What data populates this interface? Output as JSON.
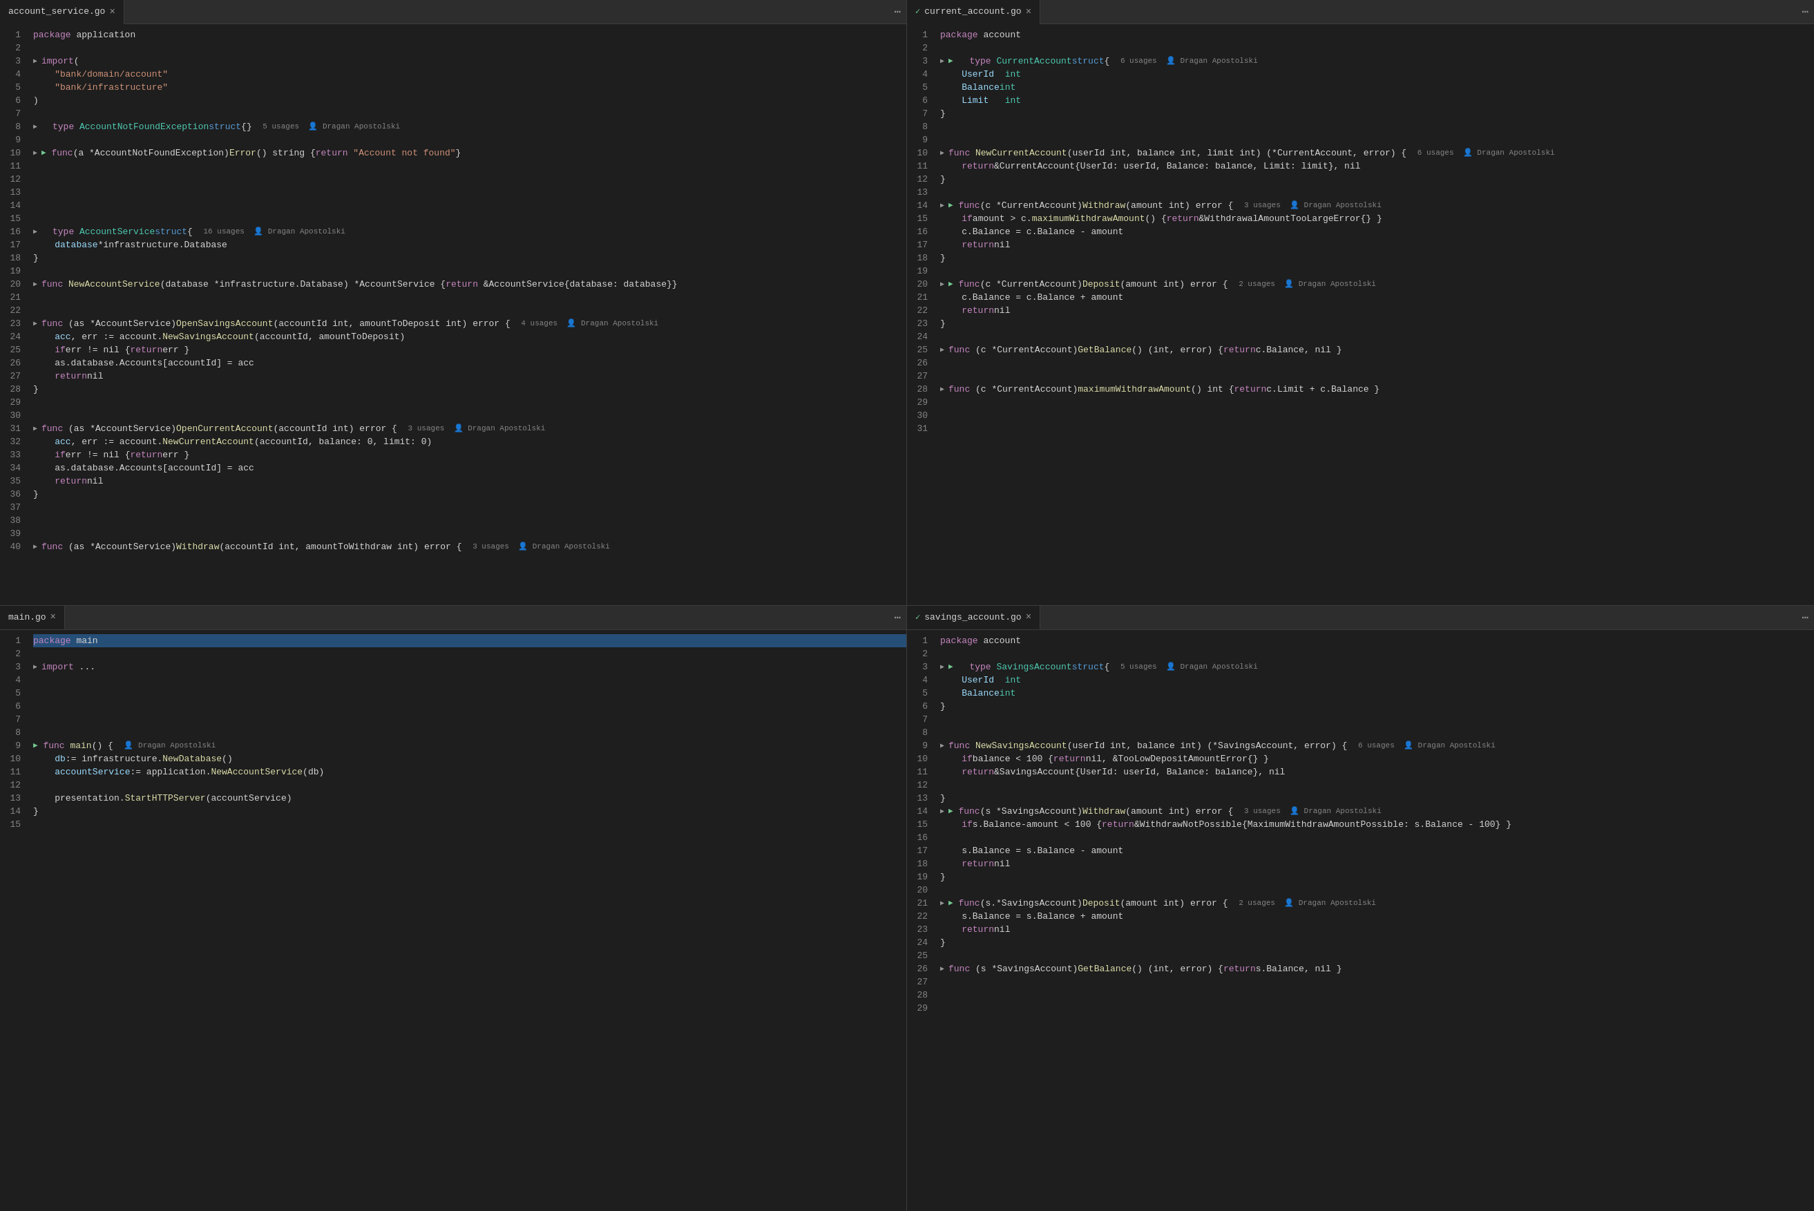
{
  "panes": [
    {
      "id": "account-service",
      "tab_name": "account_service.go",
      "tab_modified": false,
      "tab_active": true,
      "show_checkmark": false,
      "lines": [
        {
          "n": 1,
          "code": "<span class='kw'>package</span> <span class='plain'>application</span>"
        },
        {
          "n": 2,
          "code": ""
        },
        {
          "n": 3,
          "code": "<span class='kw'>import</span> <span class='plain'>(</span>"
        },
        {
          "n": 4,
          "code": "    <span class='str'>\"bank/domain/account\"</span>"
        },
        {
          "n": 5,
          "code": "    <span class='str'>\"bank/infrastructure\"</span>"
        },
        {
          "n": 6,
          "code": "<span class='plain'>)</span>"
        },
        {
          "n": 7,
          "code": ""
        },
        {
          "n": 8,
          "fold": true,
          "meta": "5 usages  👤 Dragan Apostolski",
          "code": "<span class='kw'>type</span> <span class='type'>AccountNotFoundException</span> <span class='kw-blue'>struct</span><span class='plain'>{}</span>"
        },
        {
          "n": 9,
          "code": ""
        },
        {
          "n": 10,
          "fold": true,
          "run": true,
          "meta": "",
          "code": "<span class='kw'>func</span> <span class='plain'>(a *AccountNotFoundException)</span> <span class='fn'>Error</span><span class='plain'>() string { </span><span class='kw'>return</span> <span class='str'>\"Account not found\"</span> <span class='plain'>}</span>"
        },
        {
          "n": 11,
          "code": ""
        },
        {
          "n": 12,
          "code": ""
        },
        {
          "n": 13,
          "code": ""
        },
        {
          "n": 14,
          "code": ""
        },
        {
          "n": 15,
          "code": ""
        },
        {
          "n": 16,
          "fold": true,
          "meta": "16 usages  👤 Dragan Apostolski",
          "code": "<span class='kw'>type</span> <span class='type'>AccountService</span> <span class='kw-blue'>struct</span> <span class='plain'>{</span>"
        },
        {
          "n": 17,
          "code": "    <span class='param'>database</span> <span class='plain'>*infrastructure.Database</span>"
        },
        {
          "n": 18,
          "code": "<span class='plain'>}</span>"
        },
        {
          "n": 19,
          "code": ""
        },
        {
          "n": 20,
          "fold": true,
          "code": "<span class='kw'>func</span> <span class='fn'>NewAccountService</span><span class='plain'>(database *infrastructure.Database) *AccountService { </span><span class='kw'>return</span> <span class='plain'>&AccountService{database: database}</span> <span class='plain'>}</span>"
        },
        {
          "n": 21,
          "code": ""
        },
        {
          "n": 22,
          "code": ""
        },
        {
          "n": 23,
          "fold": true,
          "meta": "4 usages  👤 Dragan Apostolski",
          "code": "<span class='kw'>func</span> <span class='plain'>(as *AccountService)</span> <span class='fn'>OpenSavingsAccount</span><span class='plain'>(accountId int, amountToDeposit int) error {</span>"
        },
        {
          "n": 24,
          "code": "    <span class='param'>acc</span><span class='plain'>, err := account.</span><span class='fn'>NewSavingsAccount</span><span class='plain'>(accountId, amountToDeposit)</span>"
        },
        {
          "n": 25,
          "code": "    <span class='kw'>if</span> <span class='plain'>err != nil {</span> <span class='kw'>return</span> <span class='plain'>err }</span>"
        },
        {
          "n": 26,
          "code": "    <span class='plain'>as.database.Accounts[accountId] = acc</span>"
        },
        {
          "n": 27,
          "code": "    <span class='kw'>return</span> <span class='plain'>nil</span>"
        },
        {
          "n": 28,
          "code": "<span class='plain'>}</span>"
        },
        {
          "n": 29,
          "code": ""
        },
        {
          "n": 30,
          "code": ""
        },
        {
          "n": 31,
          "fold": true,
          "meta": "3 usages  👤 Dragan Apostolski",
          "code": "<span class='kw'>func</span> <span class='plain'>(as *AccountService)</span> <span class='fn'>OpenCurrentAccount</span><span class='plain'>(accountId int) error {</span>"
        },
        {
          "n": 32,
          "code": "    <span class='param'>acc</span><span class='plain'>, err := account.</span><span class='fn'>NewCurrentAccount</span><span class='plain'>(accountId, balance: 0, limit: 0)</span>"
        },
        {
          "n": 33,
          "code": "    <span class='kw'>if</span> <span class='plain'>err != nil {</span> <span class='kw'>return</span> <span class='plain'>err }</span>"
        },
        {
          "n": 34,
          "code": "    <span class='plain'>as.database.Accounts[accountId] = acc</span>"
        },
        {
          "n": 35,
          "code": "    <span class='kw'>return</span> <span class='plain'>nil</span>"
        },
        {
          "n": 36,
          "code": "<span class='plain'>}</span>"
        },
        {
          "n": 37,
          "code": ""
        },
        {
          "n": 38,
          "code": ""
        },
        {
          "n": 39,
          "code": ""
        },
        {
          "n": 40,
          "fold": true,
          "meta": "3 usages  👤 Dragan Apostolski",
          "code": "<span class='kw'>func</span> <span class='plain'>(as *AccountService)</span> <span class='fn'>Withdraw</span><span class='plain'>(accountId int, amountToWithdraw int) error {</span>"
        }
      ]
    },
    {
      "id": "current-account",
      "tab_name": "current_account.go",
      "tab_modified": false,
      "tab_active": true,
      "show_checkmark": true,
      "lines": [
        {
          "n": 1,
          "code": "<span class='kw'>package</span> <span class='plain'>account</span>"
        },
        {
          "n": 2,
          "code": ""
        },
        {
          "n": 3,
          "fold": true,
          "run": true,
          "meta": "6 usages  👤 Dragan Apostolski",
          "code": "<span class='kw'>type</span> <span class='type'>CurrentAccount</span> <span class='kw-blue'>struct</span> <span class='plain'>{</span>"
        },
        {
          "n": 4,
          "code": "    <span class='param'>UserId</span>  <span class='type'>int</span>"
        },
        {
          "n": 5,
          "code": "    <span class='param'>Balance</span> <span class='type'>int</span>"
        },
        {
          "n": 6,
          "code": "    <span class='param'>Limit</span>   <span class='type'>int</span>"
        },
        {
          "n": 7,
          "code": "<span class='plain'>}</span>"
        },
        {
          "n": 8,
          "code": ""
        },
        {
          "n": 9,
          "code": ""
        },
        {
          "n": 10,
          "fold": true,
          "meta": "6 usages  👤 Dragan Apostolski",
          "code": "<span class='kw'>func</span> <span class='fn'>NewCurrentAccount</span><span class='plain'>(userId int, balance int, limit int) (*CurrentAccount, error) {</span>"
        },
        {
          "n": 11,
          "code": "    <span class='kw'>return</span> <span class='plain'>&CurrentAccount{UserId: userId, Balance: balance, Limit: limit}, nil</span>"
        },
        {
          "n": 12,
          "code": "<span class='plain'>}</span>"
        },
        {
          "n": 13,
          "code": ""
        },
        {
          "n": 14,
          "fold": true,
          "run": true,
          "meta": "3 usages  👤 Dragan Apostolski",
          "code": "<span class='kw'>func</span> <span class='plain'>(c *CurrentAccount)</span> <span class='fn'>Withdraw</span><span class='plain'>(amount int) error {</span>"
        },
        {
          "n": 15,
          "code": "    <span class='kw'>if</span> <span class='plain'>amount > c.</span><span class='fn'>maximumWithdrawAmount</span><span class='plain'>() { </span><span class='kw'>return</span> <span class='plain'>&WithdrawalAmountTooLargeError{} }</span>"
        },
        {
          "n": 16,
          "code": "    <span class='plain'>c.Balance = c.Balance - amount</span>"
        },
        {
          "n": 17,
          "code": "    <span class='kw'>return</span> <span class='plain'>nil</span>"
        },
        {
          "n": 18,
          "code": "<span class='plain'>}</span>"
        },
        {
          "n": 19,
          "code": ""
        },
        {
          "n": 20,
          "fold": true,
          "run": true,
          "meta": "2 usages  👤 Dragan Apostolski",
          "code": "<span class='kw'>func</span> <span class='plain'>(c *CurrentAccount)</span> <span class='fn'>Deposit</span><span class='plain'>(amount int) error {</span>"
        },
        {
          "n": 21,
          "code": "    <span class='plain'>c.Balance = c.Balance + amount</span>"
        },
        {
          "n": 22,
          "code": "    <span class='kw'>return</span> <span class='plain'>nil</span>"
        },
        {
          "n": 23,
          "code": "<span class='plain'>}</span>"
        },
        {
          "n": 24,
          "code": ""
        },
        {
          "n": 25,
          "fold": true,
          "code": "<span class='kw'>func</span> <span class='plain'>(c *CurrentAccount)</span> <span class='fn'>GetBalance</span><span class='plain'>() (int, error) { </span><span class='kw'>return</span> <span class='plain'>c.Balance, nil }</span>"
        },
        {
          "n": 26,
          "code": ""
        },
        {
          "n": 27,
          "code": ""
        },
        {
          "n": 28,
          "fold": true,
          "code": "<span class='kw'>func</span> <span class='plain'>(c *CurrentAccount)</span> <span class='fn'>maximumWithdrawAmount</span><span class='plain'>() int { </span><span class='kw'>return</span> <span class='plain'>c.Limit + c.Balance }</span>"
        },
        {
          "n": 29,
          "code": ""
        },
        {
          "n": 30,
          "code": ""
        },
        {
          "n": 31,
          "code": ""
        }
      ]
    },
    {
      "id": "main",
      "tab_name": "main.go",
      "tab_modified": false,
      "tab_active": true,
      "show_checkmark": false,
      "lines": [
        {
          "n": 1,
          "code": "<span class='kw'>package</span> <span class='plain'>main</span>",
          "selected": true
        },
        {
          "n": 2,
          "code": ""
        },
        {
          "n": 3,
          "fold": true,
          "code": "<span class='kw'>import</span> <span class='plain'>...</span>"
        },
        {
          "n": 4,
          "code": ""
        },
        {
          "n": 5,
          "code": ""
        },
        {
          "n": 6,
          "code": ""
        },
        {
          "n": 7,
          "code": ""
        },
        {
          "n": 8,
          "code": ""
        },
        {
          "n": 9,
          "run": true,
          "code": "<span class='kw'>func</span> <span class='fn'>main</span><span class='plain'>() {</span>  <span class='author'>👤 Dragan Apostolski</span>"
        },
        {
          "n": 10,
          "code": "    <span class='param'>db</span> <span class='plain'>:= infrastructure.</span><span class='fn'>NewDatabase</span><span class='plain'>()"
        },
        {
          "n": 11,
          "code": "    <span class='param'>accountService</span> <span class='plain'>:= application.</span><span class='fn'>NewAccountService</span><span class='plain'>(db)</span>"
        },
        {
          "n": 12,
          "code": ""
        },
        {
          "n": 13,
          "code": "    <span class='plain'>presentation.</span><span class='fn'>StartHTTPServer</span><span class='plain'>(accountService)</span>"
        },
        {
          "n": 14,
          "code": "<span class='plain'>}</span>"
        },
        {
          "n": 15,
          "code": ""
        }
      ]
    },
    {
      "id": "savings-account",
      "tab_name": "savings_account.go",
      "tab_modified": false,
      "tab_active": true,
      "show_checkmark": true,
      "lines": [
        {
          "n": 1,
          "code": "<span class='kw'>package</span> <span class='plain'>account</span>"
        },
        {
          "n": 2,
          "code": ""
        },
        {
          "n": 3,
          "fold": true,
          "run": true,
          "meta": "5 usages  👤 Dragan Apostolski",
          "code": "<span class='kw'>type</span> <span class='type'>SavingsAccount</span> <span class='kw-blue'>struct</span> <span class='plain'>{</span>"
        },
        {
          "n": 4,
          "code": "    <span class='param'>UserId</span>  <span class='type'>int</span>"
        },
        {
          "n": 5,
          "code": "    <span class='param'>Balance</span> <span class='type'>int</span>"
        },
        {
          "n": 6,
          "code": "<span class='plain'>}</span>"
        },
        {
          "n": 7,
          "code": ""
        },
        {
          "n": 8,
          "code": ""
        },
        {
          "n": 9,
          "fold": true,
          "meta": "6 usages  👤 Dragan Apostolski",
          "code": "<span class='kw'>func</span> <span class='fn'>NewSavingsAccount</span><span class='plain'>(userId int, balance int) (*SavingsAccount, error) {</span>"
        },
        {
          "n": 10,
          "code": "    <span class='kw'>if</span> <span class='plain'>balance < 100 { </span><span class='kw'>return</span> <span class='plain'>nil, &TooLowDepositAmountError{} }</span>"
        },
        {
          "n": 11,
          "code": "    <span class='kw'>return</span> <span class='plain'>&SavingsAccount{UserId: userId, Balance: balance}, nil</span>"
        },
        {
          "n": 12,
          "code": ""
        },
        {
          "n": 13,
          "code": "<span class='plain'>}</span>"
        },
        {
          "n": 14,
          "fold": true,
          "run": true,
          "meta": "3 usages  👤 Dragan Apostolski",
          "code": "<span class='kw'>func</span> <span class='plain'>(s *SavingsAccount)</span> <span class='fn'>Withdraw</span><span class='plain'>(amount int) error {</span>"
        },
        {
          "n": 15,
          "code": "    <span class='kw'>if</span> <span class='plain'>s.Balance-amount < 100 { </span><span class='kw'>return</span> <span class='plain'>&WithdrawNotPossible{MaximumWithdrawAmountPossible: s.Balance - 100} }</span>"
        },
        {
          "n": 16,
          "code": ""
        },
        {
          "n": 17,
          "code": "    <span class='plain'>s.Balance = s.Balance - amount</span>"
        },
        {
          "n": 18,
          "code": "    <span class='kw'>return</span> <span class='plain'>nil</span>"
        },
        {
          "n": 19,
          "code": "<span class='plain'>}</span>"
        },
        {
          "n": 20,
          "code": ""
        },
        {
          "n": 21,
          "fold": true,
          "run": true,
          "meta": "2 usages  👤 Dragan Apostolski",
          "code": "<span class='kw'>func</span> <span class='plain'>(s.*SavingsAccount)</span> <span class='fn'>Deposit</span><span class='plain'>(amount int) error {</span>"
        },
        {
          "n": 22,
          "code": "    <span class='plain'>s.Balance = s.Balance + amount</span>"
        },
        {
          "n": 23,
          "code": "    <span class='kw'>return</span> <span class='plain'>nil</span>"
        },
        {
          "n": 24,
          "code": "<span class='plain'>}</span>"
        },
        {
          "n": 25,
          "code": ""
        },
        {
          "n": 26,
          "fold": true,
          "code": "<span class='kw'>func</span> <span class='plain'>(s *SavingsAccount)</span> <span class='fn'>GetBalance</span><span class='plain'>() (int, error) { </span><span class='kw'>return</span> <span class='plain'>s.Balance, nil }</span>"
        },
        {
          "n": 27,
          "code": ""
        },
        {
          "n": 28,
          "code": ""
        },
        {
          "n": 29,
          "code": ""
        }
      ]
    }
  ]
}
